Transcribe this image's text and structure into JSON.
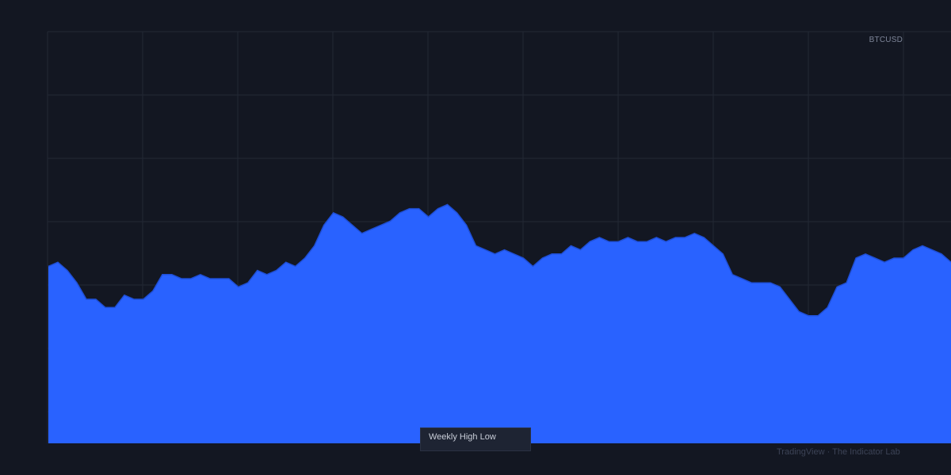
{
  "symbol": "BTCUSD",
  "indicator_label": "Weekly High Low",
  "watermark": "TradingView · The Indicator Lab",
  "colors": {
    "background": "#131722",
    "grid": "#232834",
    "area_fill": "#2962ff",
    "area_line": "#1f4fd6"
  },
  "chart_data": {
    "type": "area",
    "title": "",
    "xlabel": "",
    "ylabel": "",
    "grid": true,
    "ylim": [
      0,
      100
    ],
    "x": [
      0,
      1,
      2,
      3,
      4,
      5,
      6,
      7,
      8,
      9,
      10,
      11,
      12,
      13,
      14,
      15,
      16,
      17,
      18,
      19,
      20,
      21,
      22,
      23,
      24,
      25,
      26,
      27,
      28,
      29,
      30,
      31,
      32,
      33,
      34,
      35,
      36,
      37,
      38,
      39,
      40,
      41,
      42,
      43,
      44,
      45,
      46,
      47,
      48,
      49,
      50,
      51,
      52,
      53,
      54,
      55,
      56,
      57,
      58,
      59,
      60,
      61,
      62,
      63,
      64,
      65,
      66,
      67,
      68,
      69,
      70,
      71,
      72,
      73,
      74,
      75,
      76,
      77,
      78,
      79,
      80,
      81,
      82,
      83,
      84,
      85,
      86,
      87,
      88,
      89,
      90,
      91,
      92,
      93,
      94,
      95
    ],
    "series": [
      {
        "values": [
          43,
          44,
          42,
          39,
          35,
          35,
          33,
          33,
          36,
          35,
          35,
          37,
          41,
          41,
          40,
          40,
          41,
          40,
          40,
          40,
          38,
          39,
          42,
          41,
          42,
          44,
          43,
          45,
          48,
          53,
          56,
          55,
          53,
          51,
          52,
          53,
          54,
          56,
          57,
          57,
          55,
          57,
          58,
          56,
          53,
          48,
          47,
          46,
          47,
          46,
          45,
          43,
          45,
          46,
          46,
          48,
          47,
          49,
          50,
          49,
          49,
          50,
          49,
          49,
          50,
          49,
          50,
          50,
          51,
          50,
          48,
          46,
          41,
          40,
          39,
          39,
          39,
          38,
          35,
          32,
          31,
          31,
          33,
          38,
          39,
          45,
          46,
          45,
          44,
          45,
          45,
          47,
          48,
          47,
          46,
          44
        ]
      }
    ]
  }
}
